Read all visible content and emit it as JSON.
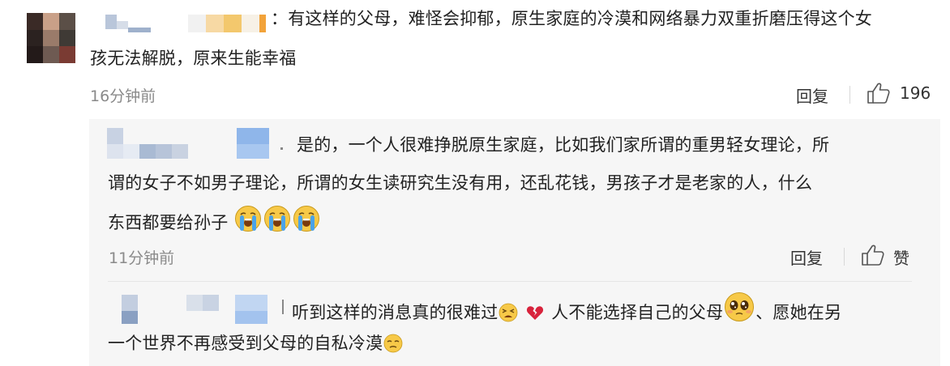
{
  "comment": {
    "separator": "：",
    "text_line1": "有这样的父母，难怪会抑郁，原生家庭的冷漠和网络暴力双重折磨压得这个女",
    "text_line2": "孩无法解脱，原来生能幸福",
    "time": "16分钟前",
    "reply_label": "回复",
    "like_count": "196"
  },
  "replies": [
    {
      "text_line1": "是的，一个人很难挣脱原生家庭，比如我们家所谓的重男轻女理论，所",
      "text_line2": "谓的女子不如男子理论，所谓的女生读研究生没有用，还乱花钱，男孩子才是老家的人，什么",
      "text_line3": "东西都要给孙子",
      "emojis": [
        "crying-face",
        "crying-face",
        "crying-face"
      ],
      "time": "11分钟前",
      "reply_label": "回复",
      "like_label": "赞"
    },
    {
      "text_part1": "听到这样的消息真的很难过",
      "text_part2": "人不能选择自己的父母",
      "text_part3": "、愿她在另",
      "text_line2": "一个世界不再感受到父母的自私冷漠",
      "emojis": [
        "tired-face",
        "broken-heart",
        "pleading-face",
        "unamused-face"
      ]
    }
  ],
  "colors": {
    "text": "#222222",
    "muted": "#8a8a8a",
    "reply_bg": "#f6f6f6",
    "emoji_yellow": "#f7c948",
    "tears_blue": "#4aa3e8",
    "heart_red": "#d8233c"
  }
}
